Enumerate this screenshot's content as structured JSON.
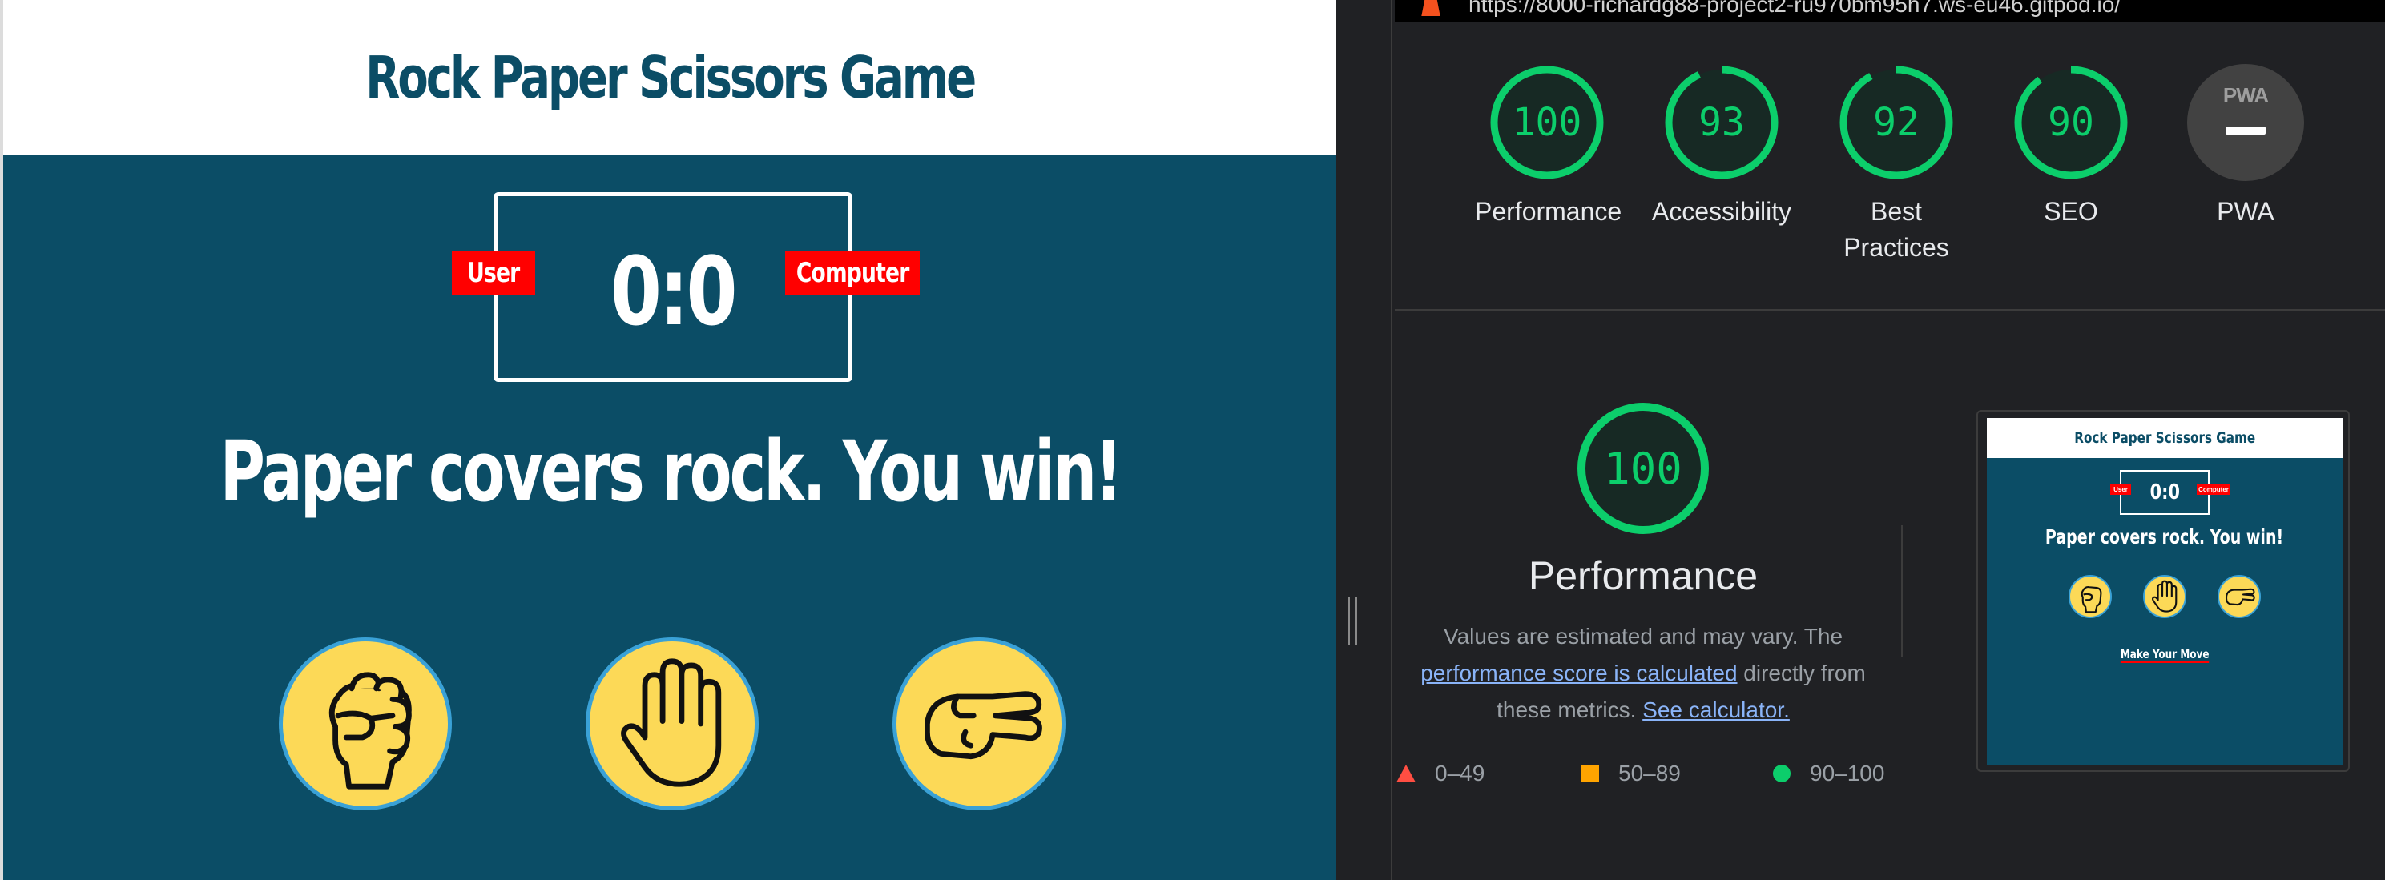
{
  "colors": {
    "game_bg": "#0b4d66",
    "tag_red": "#ff0000",
    "choice_yellow": "#fcd957",
    "choice_border": "#3aa1d6",
    "score_green": "#0cce6b",
    "devtools_bg": "#202124"
  },
  "game": {
    "title": "Rock Paper Scissors Game",
    "score": "0:0",
    "user_label": "User",
    "computer_label": "Computer",
    "result": "Paper covers rock. You win!",
    "choices": [
      {
        "name": "rock",
        "icon": "fist-icon"
      },
      {
        "name": "paper",
        "icon": "open-hand-icon"
      },
      {
        "name": "scissors",
        "icon": "scissors-hand-icon"
      }
    ]
  },
  "lighthouse": {
    "url": "https://8000-richardg88-project2-ru970bm95h7.ws-eu46.gitpod.io/",
    "scores": [
      {
        "label": "Performance",
        "value": "100",
        "fraction": 1.0
      },
      {
        "label": "Accessibility",
        "value": "93",
        "fraction": 0.93
      },
      {
        "label": "Best Practices",
        "value": "92",
        "fraction": 0.92
      },
      {
        "label": "SEO",
        "value": "90",
        "fraction": 0.9
      }
    ],
    "pwa": {
      "label": "PWA",
      "badge": "PWA"
    },
    "detail": {
      "score": "100",
      "score_fraction": 1.0,
      "title": "Performance",
      "desc_1": "Values are estimated and may vary. The ",
      "desc_link_1": "performance score is calculated",
      "desc_2": " directly from these metrics. ",
      "desc_link_2": "See calculator."
    },
    "legend": {
      "fail": "0–49",
      "average": "50–89",
      "pass": "90–100"
    },
    "thumbnail": {
      "title": "Rock Paper Scissors Game",
      "score": "0:0",
      "user_label": "User",
      "computer_label": "Computer",
      "result": "Paper covers rock. You win!",
      "move_label": "Make Your Move"
    }
  }
}
